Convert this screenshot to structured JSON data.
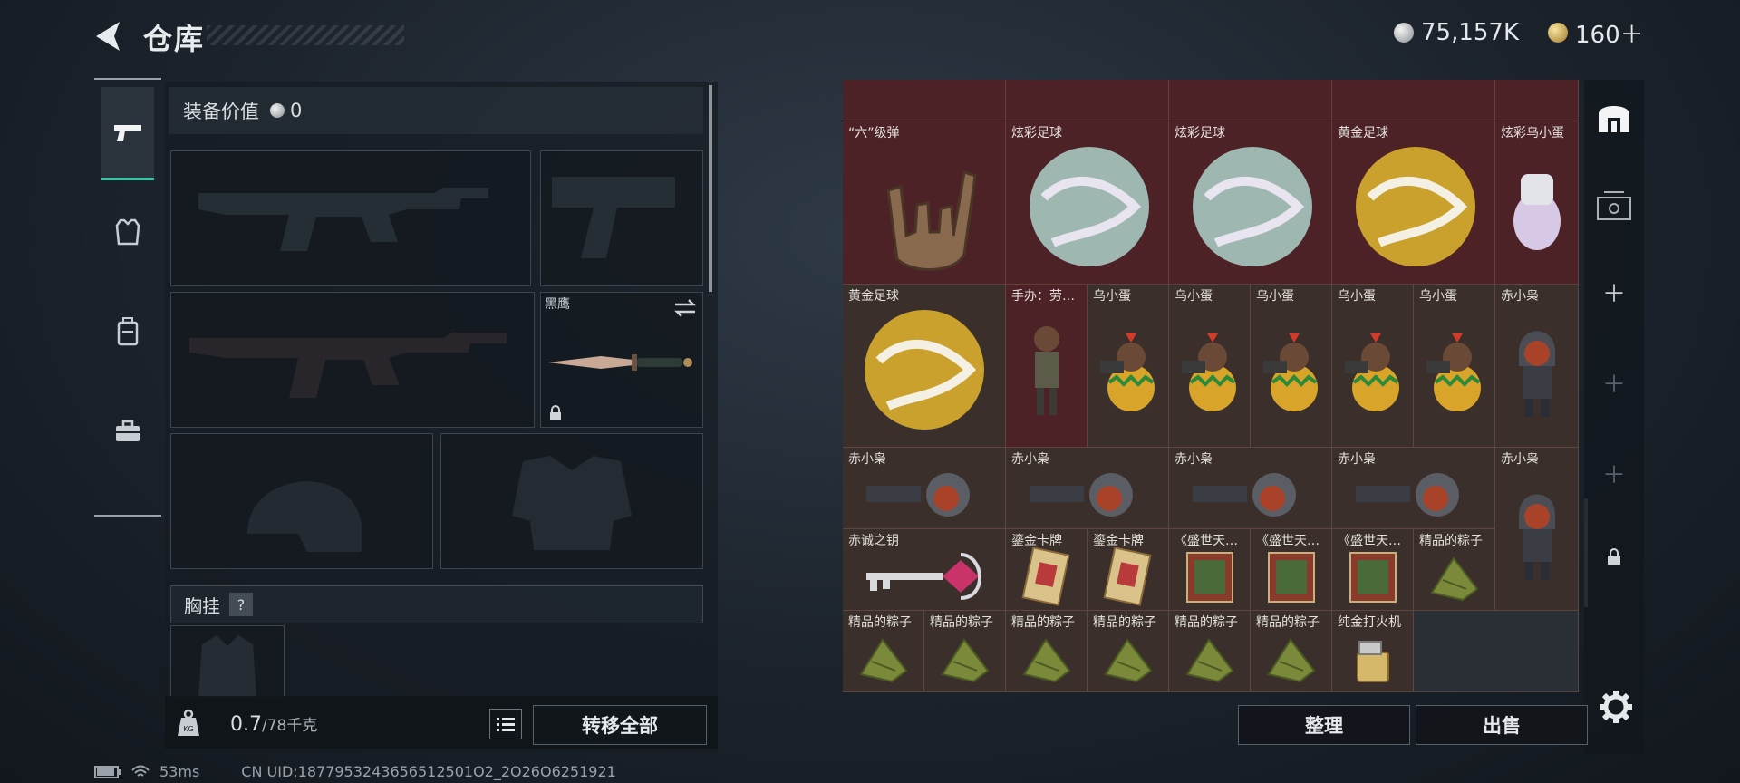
{
  "header": {
    "title": "仓库",
    "currency_silver": "75,157K",
    "currency_gold": "160＋"
  },
  "loadout": {
    "value_label": "装备价值",
    "value": "0",
    "knife_name": "黑鹰",
    "section_title": "胸挂",
    "section_help": "?"
  },
  "footer": {
    "weight_value": "0.7",
    "weight_max": "/78千克",
    "transfer_all": "转移全部",
    "sort": "整理",
    "sell": "出售"
  },
  "status": {
    "ping": "53ms",
    "uid": "CN UID:1877953243656512501O2_2O26O6251921"
  },
  "items": [
    {
      "name": "“六”级弹",
      "icon": "hand-sign-icon"
    },
    {
      "name": "炫彩足球",
      "icon": "iridescent-ball-icon"
    },
    {
      "name": "炫彩足球",
      "icon": "iridescent-ball-icon"
    },
    {
      "name": "黄金足球",
      "icon": "golden-ball-icon"
    },
    {
      "name": "炫彩乌小蛋",
      "icon": "egg-figure-icon"
    },
    {
      "name": "黄金足球",
      "icon": "golden-ball-icon"
    },
    {
      "name": "手办：劳…",
      "icon": "figurine-icon"
    },
    {
      "name": "乌小蛋",
      "icon": "egg-soldier-icon"
    },
    {
      "name": "乌小蛋",
      "icon": "egg-soldier-icon"
    },
    {
      "name": "乌小蛋",
      "icon": "egg-soldier-icon"
    },
    {
      "name": "乌小蛋",
      "icon": "egg-soldier-icon"
    },
    {
      "name": "乌小蛋",
      "icon": "egg-soldier-icon"
    },
    {
      "name": "赤小枭",
      "icon": "hooded-figure-icon"
    },
    {
      "name": "赤小枭",
      "icon": "hooded-figure-lying-icon"
    },
    {
      "name": "赤小枭",
      "icon": "hooded-figure-lying-icon"
    },
    {
      "name": "赤小枭",
      "icon": "hooded-figure-lying-icon"
    },
    {
      "name": "赤小枭",
      "icon": "hooded-figure-lying-icon"
    },
    {
      "name": "赤小枭",
      "icon": "hooded-figure-icon"
    },
    {
      "name": "赤诚之钥",
      "icon": "key-icon"
    },
    {
      "name": "鎏金卡牌",
      "icon": "card-icon"
    },
    {
      "name": "鎏金卡牌",
      "icon": "card-icon"
    },
    {
      "name": "《盛世天…",
      "icon": "album-icon"
    },
    {
      "name": "《盛世天…",
      "icon": "album-icon"
    },
    {
      "name": "《盛世天…",
      "icon": "album-icon"
    },
    {
      "name": "精品的粽子",
      "icon": "zongzi-icon"
    },
    {
      "name": "精品的粽子",
      "icon": "zongzi-icon"
    },
    {
      "name": "精品的粽子",
      "icon": "zongzi-icon"
    },
    {
      "name": "精品的粽子",
      "icon": "zongzi-icon"
    },
    {
      "name": "精品的粽子",
      "icon": "zongzi-icon"
    },
    {
      "name": "精品的粽子",
      "icon": "zongzi-icon"
    },
    {
      "name": "精品的粽子",
      "icon": "zongzi-icon"
    },
    {
      "name": "纯金打火机",
      "icon": "lighter-icon"
    }
  ]
}
